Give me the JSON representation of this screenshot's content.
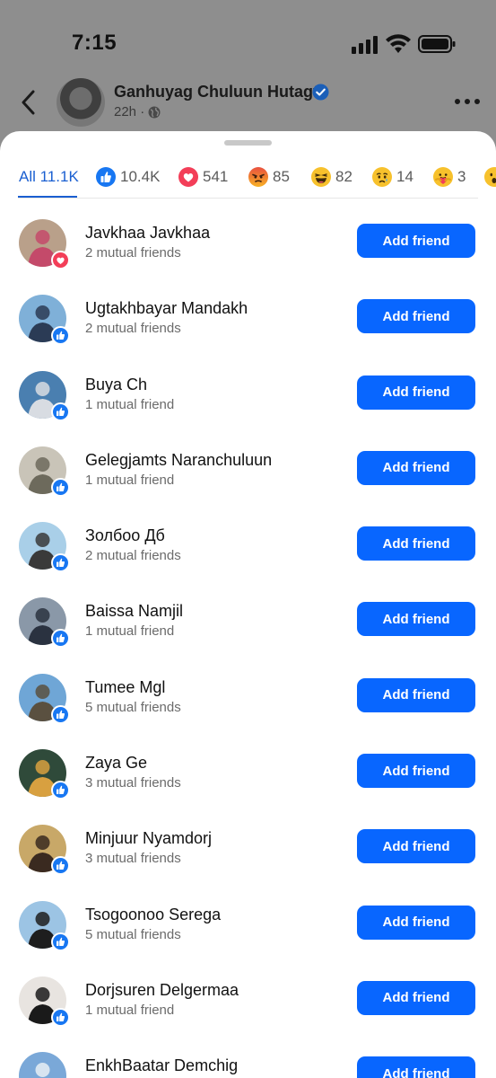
{
  "status_bar": {
    "time": "7:15"
  },
  "post": {
    "author": "Ganhuyag Chuluun Hutagt",
    "time": "22h ·"
  },
  "tabs": [
    {
      "label": "All 11.1K",
      "icon": null
    },
    {
      "label": "10.4K",
      "icon": "like-icon"
    },
    {
      "label": "541",
      "icon": "love-icon"
    },
    {
      "label": "85",
      "icon": "angry-icon"
    },
    {
      "label": "82",
      "icon": "haha-icon"
    },
    {
      "label": "14",
      "icon": "sad-icon"
    },
    {
      "label": "3",
      "icon": "care-icon"
    }
  ],
  "add_friend_label": "Add friend",
  "people": [
    {
      "name": "Javkhaa Javkhaa",
      "mutual": "2 mutual friends",
      "reaction": "love",
      "bg": "#b9a08a",
      "accent": "#c44a6a"
    },
    {
      "name": "Ugtakhbayar Mandakh",
      "mutual": "2 mutual friends",
      "reaction": "like",
      "bg": "#7fb0d8",
      "accent": "#2b3b55"
    },
    {
      "name": "Buya Ch",
      "mutual": "1 mutual friend",
      "reaction": "like",
      "bg": "#4a7fb0",
      "accent": "#d8dce2"
    },
    {
      "name": "Gelegjamts Naranchuluun",
      "mutual": "1 mutual friend",
      "reaction": "like",
      "bg": "#c9c4b8",
      "accent": "#6d6a5c"
    },
    {
      "name": "Золбоо Дб",
      "mutual": "2 mutual friends",
      "reaction": "like",
      "bg": "#a9cfe8",
      "accent": "#3a3a3a"
    },
    {
      "name": "Baissa Namjil",
      "mutual": "1 mutual friend",
      "reaction": "like",
      "bg": "#8a98a8",
      "accent": "#2a3240"
    },
    {
      "name": "Tumee Mgl",
      "mutual": "5 mutual friends",
      "reaction": "like",
      "bg": "#6fa6d6",
      "accent": "#5a5040"
    },
    {
      "name": "Zaya Ge",
      "mutual": "3 mutual friends",
      "reaction": "like",
      "bg": "#2f4a3a",
      "accent": "#d8a040"
    },
    {
      "name": "Minjuur Nyamdorj",
      "mutual": "3 mutual friends",
      "reaction": "like",
      "bg": "#c8a868",
      "accent": "#3a2a20"
    },
    {
      "name": "Tsogoonoo Serega",
      "mutual": "5 mutual friends",
      "reaction": "like",
      "bg": "#9cc4e4",
      "accent": "#1e1e1e"
    },
    {
      "name": "Dorjsuren Delgermaa",
      "mutual": "1 mutual friend",
      "reaction": "like",
      "bg": "#e8e4e0",
      "accent": "#1a1a1a"
    },
    {
      "name": "EnkhBaatar Demchig",
      "mutual": "",
      "reaction": "like",
      "bg": "#7aa8d8",
      "accent": "#e8eef4"
    }
  ],
  "colors": {
    "accent": "#0866ff",
    "like": "#1877f2",
    "love": "#f33e58"
  }
}
